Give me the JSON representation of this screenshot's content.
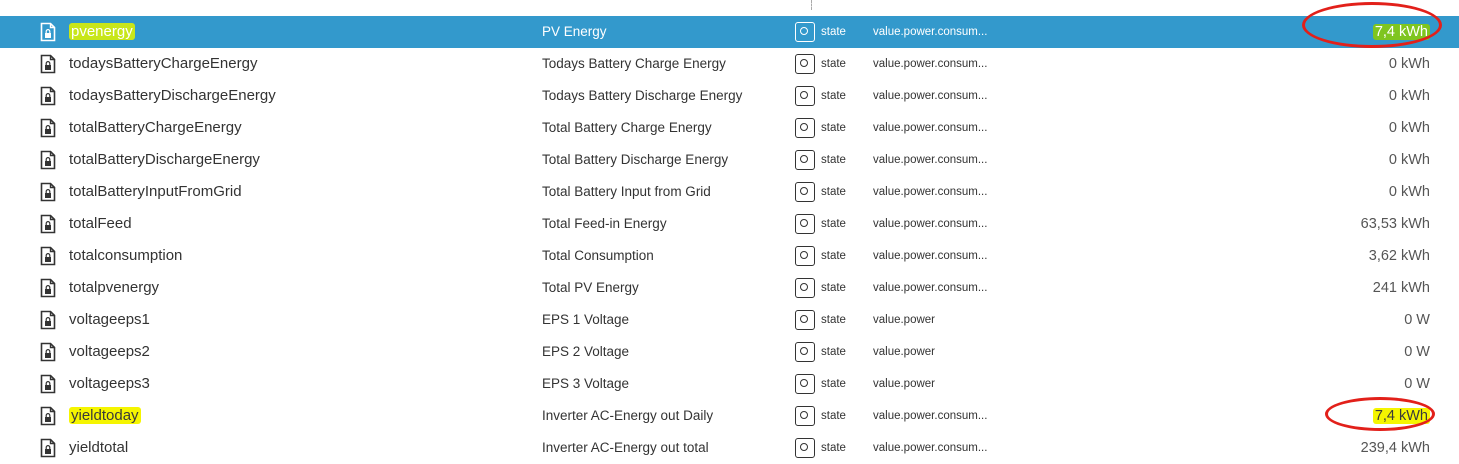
{
  "rows": [
    {
      "id": "pvenergy",
      "name": "PV Energy",
      "role": "state",
      "type": "value.power.consum...",
      "value": "7,4 kWh"
    },
    {
      "id": "todaysBatteryChargeEnergy",
      "name": "Todays Battery Charge Energy",
      "role": "state",
      "type": "value.power.consum...",
      "value": "0 kWh"
    },
    {
      "id": "todaysBatteryDischargeEnergy",
      "name": "Todays Battery Discharge Energy",
      "role": "state",
      "type": "value.power.consum...",
      "value": "0 kWh"
    },
    {
      "id": "totalBatteryChargeEnergy",
      "name": "Total Battery Charge Energy",
      "role": "state",
      "type": "value.power.consum...",
      "value": "0 kWh"
    },
    {
      "id": "totalBatteryDischargeEnergy",
      "name": "Total Battery Discharge Energy",
      "role": "state",
      "type": "value.power.consum...",
      "value": "0 kWh"
    },
    {
      "id": "totalBatteryInputFromGrid",
      "name": "Total Battery Input from Grid",
      "role": "state",
      "type": "value.power.consum...",
      "value": "0 kWh"
    },
    {
      "id": "totalFeed",
      "name": "Total Feed-in Energy",
      "role": "state",
      "type": "value.power.consum...",
      "value": "63,53 kWh"
    },
    {
      "id": "totalconsumption",
      "name": "Total Consumption",
      "role": "state",
      "type": "value.power.consum...",
      "value": "3,62 kWh"
    },
    {
      "id": "totalpvenergy",
      "name": "Total PV Energy",
      "role": "state",
      "type": "value.power.consum...",
      "value": "241 kWh"
    },
    {
      "id": "voltageeps1",
      "name": "EPS 1 Voltage",
      "role": "state",
      "type": "value.power",
      "value": "0 W"
    },
    {
      "id": "voltageeps2",
      "name": "EPS 2 Voltage",
      "role": "state",
      "type": "value.power",
      "value": "0 W"
    },
    {
      "id": "voltageeps3",
      "name": "EPS 3 Voltage",
      "role": "state",
      "type": "value.power",
      "value": "0 W"
    },
    {
      "id": "yieldtoday",
      "name": "Inverter AC-Energy out Daily",
      "role": "state",
      "type": "value.power.consum...",
      "value": "7,4 kWh"
    },
    {
      "id": "yieldtotal",
      "name": "Inverter AC-Energy out total",
      "role": "state",
      "type": "value.power.consum...",
      "value": "239,4 kWh"
    }
  ],
  "selected_row_index": 0,
  "colors": {
    "selected_bg": "#3399cc",
    "highlight_yellow": "#f5f500",
    "highlight_green": "#7fc520",
    "annotation_red": "#e2201a"
  },
  "icons": {
    "row_icon": "file-lock-icon",
    "role_icon": "state-role-icon"
  }
}
